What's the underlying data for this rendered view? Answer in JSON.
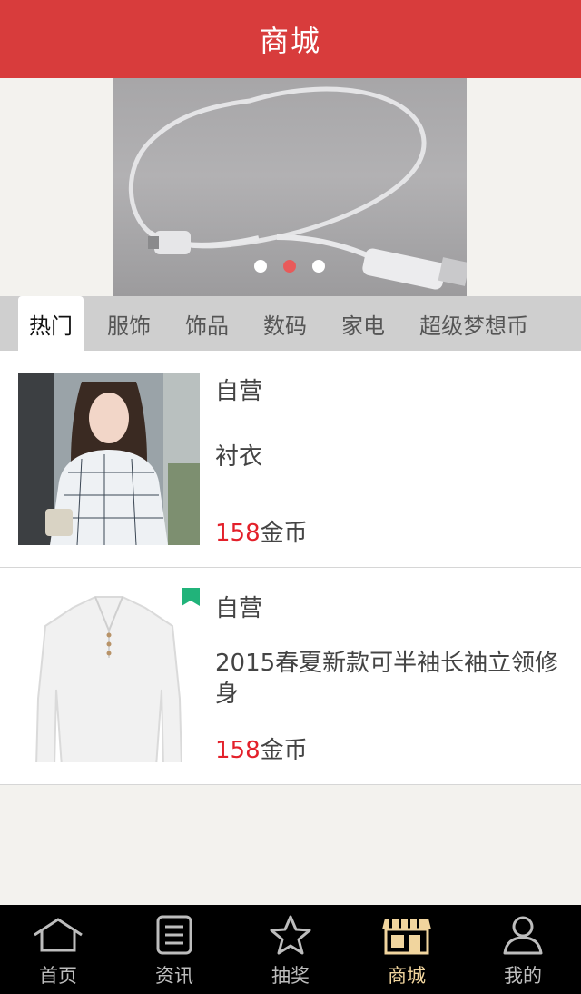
{
  "header": {
    "title": "商城"
  },
  "banner": {
    "dots": 3,
    "active_dot": 1
  },
  "tabs": [
    {
      "label": "热门",
      "active": true
    },
    {
      "label": "服饰",
      "active": false
    },
    {
      "label": "饰品",
      "active": false
    },
    {
      "label": "数码",
      "active": false
    },
    {
      "label": "家电",
      "active": false
    },
    {
      "label": "超级梦想币",
      "active": false
    }
  ],
  "products": [
    {
      "tag": "自营",
      "name": "衬衣",
      "price": "158",
      "unit": "金币"
    },
    {
      "tag": "自营",
      "name": "2015春夏新款可半袖长袖立领修身",
      "price": "158",
      "unit": "金币"
    }
  ],
  "tabbar": [
    {
      "label": "首页",
      "icon": "home-icon",
      "active": false
    },
    {
      "label": "资讯",
      "icon": "document-icon",
      "active": false
    },
    {
      "label": "抽奖",
      "icon": "star-icon",
      "active": false
    },
    {
      "label": "商城",
      "icon": "store-icon",
      "active": true
    },
    {
      "label": "我的",
      "icon": "user-icon",
      "active": false
    }
  ],
  "colors": {
    "header": "#d83c3c",
    "price": "#e3202a",
    "active_tab_label": "#f1d59e"
  }
}
